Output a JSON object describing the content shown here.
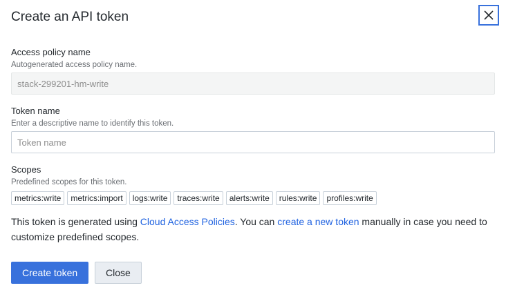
{
  "dialog": {
    "title": "Create an API token",
    "close_icon": "close-icon"
  },
  "access_policy": {
    "label": "Access policy name",
    "description": "Autogenerated access policy name.",
    "value": "stack-299201-hm-write"
  },
  "token_name": {
    "label": "Token name",
    "description": "Enter a descriptive name to identify this token.",
    "placeholder": "Token name",
    "value": ""
  },
  "scopes": {
    "label": "Scopes",
    "description": "Predefined scopes for this token.",
    "items": [
      "metrics:write",
      "metrics:import",
      "logs:write",
      "traces:write",
      "alerts:write",
      "rules:write",
      "profiles:write"
    ]
  },
  "info": {
    "text_1": "This token is generated using ",
    "link_1": "Cloud Access Policies",
    "text_2": ". You can ",
    "link_2": "create a new token",
    "text_3": " manually in case you need to customize predefined scopes."
  },
  "buttons": {
    "create_label": "Create token",
    "close_label": "Close"
  },
  "colors": {
    "primary": "#3871dc",
    "link": "#1f62e0"
  }
}
